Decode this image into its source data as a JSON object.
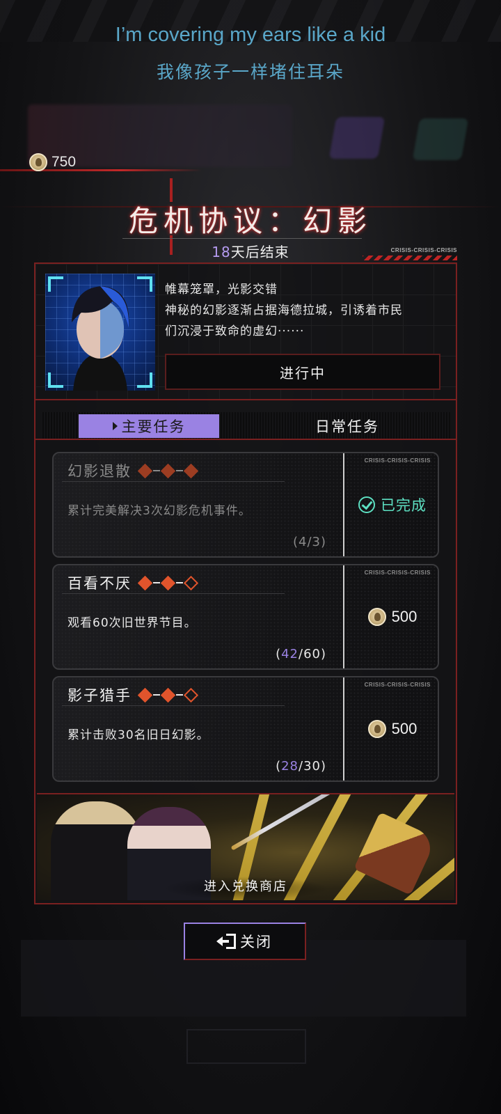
{
  "subtitle": {
    "en": "I’m covering my ears like a kid",
    "zh": "我像孩子一样堵住耳朵"
  },
  "currency": {
    "amount": "750",
    "icon": "coin-icon"
  },
  "event": {
    "title": "危机协议：幻影",
    "days_left": "18",
    "ends_suffix": "天后结束",
    "crisis_tag": "CRISIS-CRISIS-CRISIS",
    "description": [
      "帷幕笼罩，光影交错",
      "神秘的幻影逐渐占据海德拉城，引诱着市民",
      "们沉浸于致命的虚幻······"
    ],
    "status": "进行中"
  },
  "tabs": {
    "main": "主要任务",
    "daily": "日常任务"
  },
  "tasks": [
    {
      "name": "幻影退散",
      "desc": "累计完美解决3次幻影危机事件。",
      "progress_open": "(",
      "progress_current": "4",
      "progress_total": "/3)",
      "status_label": "已完成",
      "tag": "CRISIS-CRISIS-CRISIS",
      "stars_filled": 3
    },
    {
      "name": "百看不厌",
      "desc": "观看60次旧世界节目。",
      "progress_open": "(",
      "progress_current": "42",
      "progress_total": "/60)",
      "reward": "500",
      "tag": "CRISIS-CRISIS-CRISIS",
      "stars_filled": 2
    },
    {
      "name": "影子猎手",
      "desc": "累计击败30名旧日幻影。",
      "progress_open": "(",
      "progress_current": "28",
      "progress_total": "/30)",
      "reward": "500",
      "tag": "CRISIS-CRISIS-CRISIS",
      "stars_filled": 2
    }
  ],
  "shop": {
    "label": "进入兑换商店"
  },
  "close": {
    "label": "关闭"
  },
  "colors": {
    "accent_purple": "#9a82e3",
    "frame_red": "#7a2020",
    "complete_teal": "#5de0c2",
    "subtitle_blue": "#5aa7c9"
  }
}
